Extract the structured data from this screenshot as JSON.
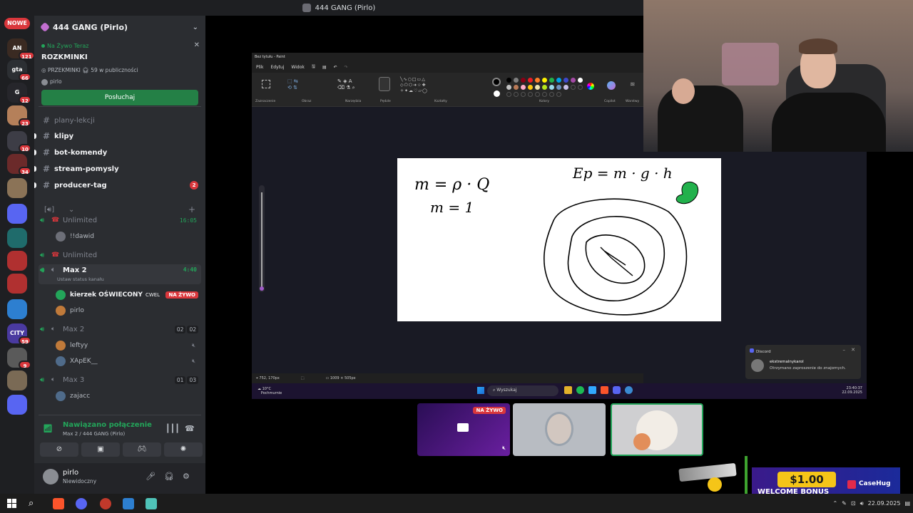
{
  "top_title": "444 GANG (Pirlo)",
  "rail": {
    "new_badge": "NOWE",
    "servers": [
      {
        "label": "AN",
        "badge": "121",
        "color": "#3a2a22"
      },
      {
        "label": "gta",
        "badge": "66",
        "color": "#2c2f33"
      },
      {
        "label": "G",
        "badge": "12",
        "color": "#26262b"
      },
      {
        "label": "",
        "badge": "23",
        "color": "#b5805a"
      },
      {
        "label": "",
        "badge": "10",
        "color": "#3d3d46"
      },
      {
        "label": "",
        "badge": "34",
        "color": "#6b2a2a"
      },
      {
        "label": "",
        "badge": "",
        "color": "#8b7357"
      },
      {
        "label": "",
        "badge": "",
        "color": "#5865f2"
      },
      {
        "label": "",
        "badge": "",
        "color": "#1f6b6b"
      },
      {
        "label": "",
        "badge": "",
        "color": "#b03030"
      },
      {
        "label": "",
        "badge": "",
        "color": "#b03030"
      },
      {
        "label": "",
        "badge": "",
        "color": "#2d7fd0"
      },
      {
        "label": "CITY",
        "badge": "59",
        "color": "#4a3aa0"
      },
      {
        "label": "",
        "badge": "9",
        "color": "#5a5a5a"
      },
      {
        "label": "",
        "badge": "",
        "color": "#7a6a55"
      },
      {
        "label": "",
        "badge": "",
        "color": "#5865f2"
      }
    ]
  },
  "server": {
    "name": "444 GANG (Pirlo)"
  },
  "live_now": {
    "label": "Na Żywo Teraz",
    "title": "ROZKMINKI",
    "channel": "PRZEKMINKI",
    "audience": "59 w publiczności",
    "host": "pirlo",
    "button": "Posłuchaj"
  },
  "text_channels": [
    {
      "name": "plany-lekcji",
      "unread": false,
      "mention": ""
    },
    {
      "name": "klipy",
      "unread": true,
      "mention": ""
    },
    {
      "name": "bot-komendy",
      "unread": true,
      "mention": ""
    },
    {
      "name": "stream-pomysly",
      "unread": true,
      "mention": ""
    },
    {
      "name": "producer-tag",
      "unread": true,
      "mention": "2"
    }
  ],
  "voice_channels": [
    {
      "name": "Unlimited",
      "timer": "16:05",
      "members": [
        {
          "name": "!!dawid"
        }
      ]
    },
    {
      "name": "Unlimited",
      "timer": "",
      "members": []
    },
    {
      "name": "Max 2",
      "timer": "4:40",
      "status": "Ustaw status kanału",
      "members": [
        {
          "name": "kierzek OŚWIECONY",
          "tag": "CWEL",
          "live": "NA ŻYWO"
        },
        {
          "name": "pirlo"
        }
      ]
    },
    {
      "name": "Max 2",
      "counts": [
        "02",
        "02"
      ],
      "members": [
        {
          "name": "leftyy"
        },
        {
          "name": "XApEK__"
        }
      ]
    },
    {
      "name": "Max 3",
      "counts": [
        "01",
        "03"
      ],
      "members": [
        {
          "name": "zajacc"
        }
      ]
    }
  ],
  "voice_status": {
    "title": "Nawiązano połączenie",
    "sub": "Max 2 / 444 GANG (Pirlo)"
  },
  "user": {
    "name": "pirlo",
    "status": "Niewidoczny"
  },
  "paint": {
    "title": "Bez tytułu - Paint",
    "menu": [
      "Plik",
      "Edytuj",
      "Widok"
    ],
    "groups": [
      "Zaznaczenie",
      "Obraz",
      "Narzędzia",
      "Pędzle",
      "Kształty",
      "Kolory",
      "Copilot",
      "Warstwy"
    ],
    "status_pos": "752, 170px",
    "status_size": "1009 × 505px",
    "palette": [
      "#000000",
      "#7f7f7f",
      "#880015",
      "#ed1c24",
      "#ff7f27",
      "#fff200",
      "#22b14c",
      "#00a2e8",
      "#3f48cc",
      "#a349a4",
      "#ffffff",
      "#c3c3c3",
      "#b97a57",
      "#ffaec9",
      "#ffc90e",
      "#efe4b0",
      "#b5e61d",
      "#99d9ea",
      "#7092be",
      "#c8bfe7"
    ]
  },
  "canvas_text": {
    "eq1": "m = ρ · Q",
    "eq2": "m = 1",
    "eq3": "Ep = m · g · h"
  },
  "toast": {
    "app": "Discord",
    "user": "ekstremalnykarol",
    "msg": "Otrzymano zaproszenie do znajomych."
  },
  "guest_taskbar": {
    "weather": "10°C",
    "weather_sub": "Pochmurnie",
    "search": "Wyszukaj",
    "time": "23:40:37",
    "date": "22.09.2025"
  },
  "thumbs": {
    "live_label": "NA ŻYWO"
  },
  "ad": {
    "amount": "$1.00",
    "text": "WELCOME BONUS",
    "brand": "CaseHug"
  },
  "taskbar": {
    "date": "22.09.2025"
  }
}
